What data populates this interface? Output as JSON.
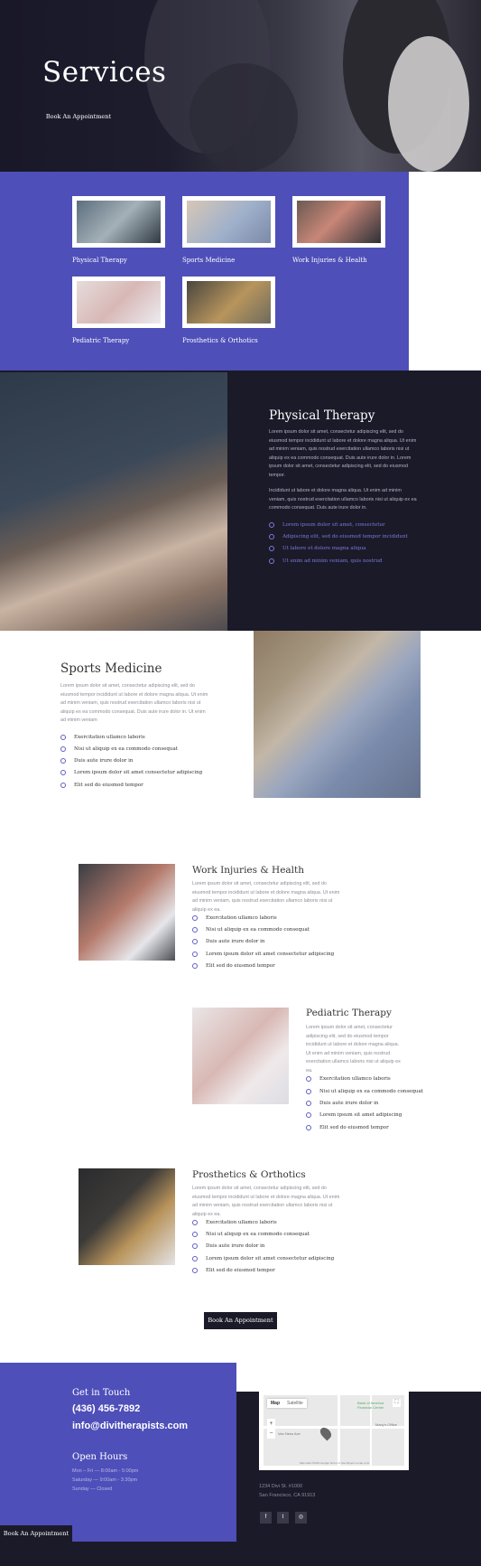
{
  "hero": {
    "title": "Services",
    "button": "Book An Appointment"
  },
  "services_grid": [
    {
      "label": "Physical Therapy"
    },
    {
      "label": "Sports Medicine"
    },
    {
      "label": "Work Injuries & Health"
    },
    {
      "label": "Pediatric Therapy"
    },
    {
      "label": "Prosthetics & Orthotics"
    }
  ],
  "physical_therapy": {
    "title": "Physical Therapy",
    "p1": "Lorem ipsum dolor sit amet, consectetur adipiscing elit, sed do eiusmod tempor incididunt ut labore et dolore magna aliqua. Ut enim ad minim veniam, quis nostrud exercitation ullamco laboris nisi ut aliquip ex ea commodo consequat. Duis aute irure dolor in. Lorem ipsum dolor sit amet, consectetur adipiscing elit, sed do eiusmod tempor.",
    "p2": "Incididunt ut labore et dolore magna aliqua. Ut enim ad minim veniam, quis nostrud exercitation ullamco laboris nisi ut aliquip ex ea commodo consequat. Duis aute irure dolor in.",
    "items": [
      "Lorem ipsum dolor sit amet, consectetur",
      "Adipiscing elit, sed do eiusmod tempor incididunt",
      "Ut labore et dolore magna aliqua",
      "Ut enim ad minim veniam, quis nostrud"
    ]
  },
  "sports_medicine": {
    "title": "Sports Medicine",
    "p": "Lorem ipsum dolor sit amet, consectetur adipiscing elit, sed do eiusmod tempor incididunt ut labore et dolore magna aliqua. Ut enim ad minim veniam, quis nostrud exercitation ullamco laboris nisi ut aliquip ex ea commodo consequat. Duis aute irure dolor in. Ut enim ad minim veniam",
    "items": [
      "Exercitation ullamco laboris",
      "Nisi ut aliquip ex ea commodo consequat",
      "Duis aute irure dolor in",
      "Lorem ipsum dolor sit amet consectetur adipiscing",
      "Elit sed do eiusmod tempor"
    ]
  },
  "work_injuries": {
    "title": "Work Injuries & Health",
    "p": "Lorem ipsum dolor sit amet, consectetur adipiscing elit, sed do eiusmod tempor incididunt ut labore et dolore magna aliqua. Ut enim ad minim veniam, quis nostrud exercitation ullamco laboris nisi ut aliquip ex ea.",
    "items": [
      "Exercitation ullamco laboris",
      "Nisi ut aliquip ex ea commodo consequat",
      "Duis aute irure dolor in",
      "Lorem ipsum dolor sit amet consectetur adipiscing",
      "Elit sed do eiusmod tempor"
    ]
  },
  "pediatric": {
    "title": "Pediatric Therapy",
    "p": "Lorem ipsum dolor sit amet, consectetur adipiscing elit, sed do eiusmod tempor incididunt ut labore et dolore magna aliqua. Ut enim ad minim veniam, quis nostrud exercitation ullamco laboris nisi ut aliquip ex ea.",
    "items": [
      "Exercitation ullamco laboris",
      "Nisi ut aliquip ex ea commodo consequat",
      "Duis aute irure dolor in",
      "Lorem ipsum sit amet adipiscing",
      "Elit sed do eiusmod tempor"
    ]
  },
  "prosthetics": {
    "title": "Prosthetics & Orthotics",
    "p": "Lorem ipsum dolor sit amet, consectetur adipiscing elit, sed do eiusmod tempor incididunt ut labore et dolore magna aliqua. Ut enim ad minim veniam, quis nostrud exercitation ullamco laboris nisi ut aliquip ex ea.",
    "items": [
      "Exercitation ullamco laboris",
      "Nisi ut aliquip ex ea commodo consequat",
      "Duis aute irure dolor in",
      "Lorem ipsum dolor sit amet consectetur adipiscing",
      "Elit sed do eiusmod tempor"
    ]
  },
  "cta": {
    "button": "Book An Appointment"
  },
  "footer": {
    "get_in_touch": "Get in Touch",
    "phone": "(436) 456-7892",
    "email": "info@divitherapists.com",
    "open_hours": "Open Hours",
    "hours": [
      "Mon – Fri — 8:00am - 5:00pm",
      "Saturday — 9:00am - 3:30pm",
      "Sunday — Closed"
    ],
    "button": "Book An Appointment",
    "map": {
      "tab_map": "Map",
      "tab_satellite": "Satellite",
      "poi1": "Bank of America Financial Center",
      "poi2": "Macy's Office",
      "street": "Van Ness Ave",
      "footer_text": "Map data ©2019 Google   Terms of Use   Report a map error"
    },
    "address1": "1234 Divi St. #1000",
    "address2": "San Francisco, CA 91913",
    "social": [
      "f",
      "t",
      "◎"
    ]
  }
}
